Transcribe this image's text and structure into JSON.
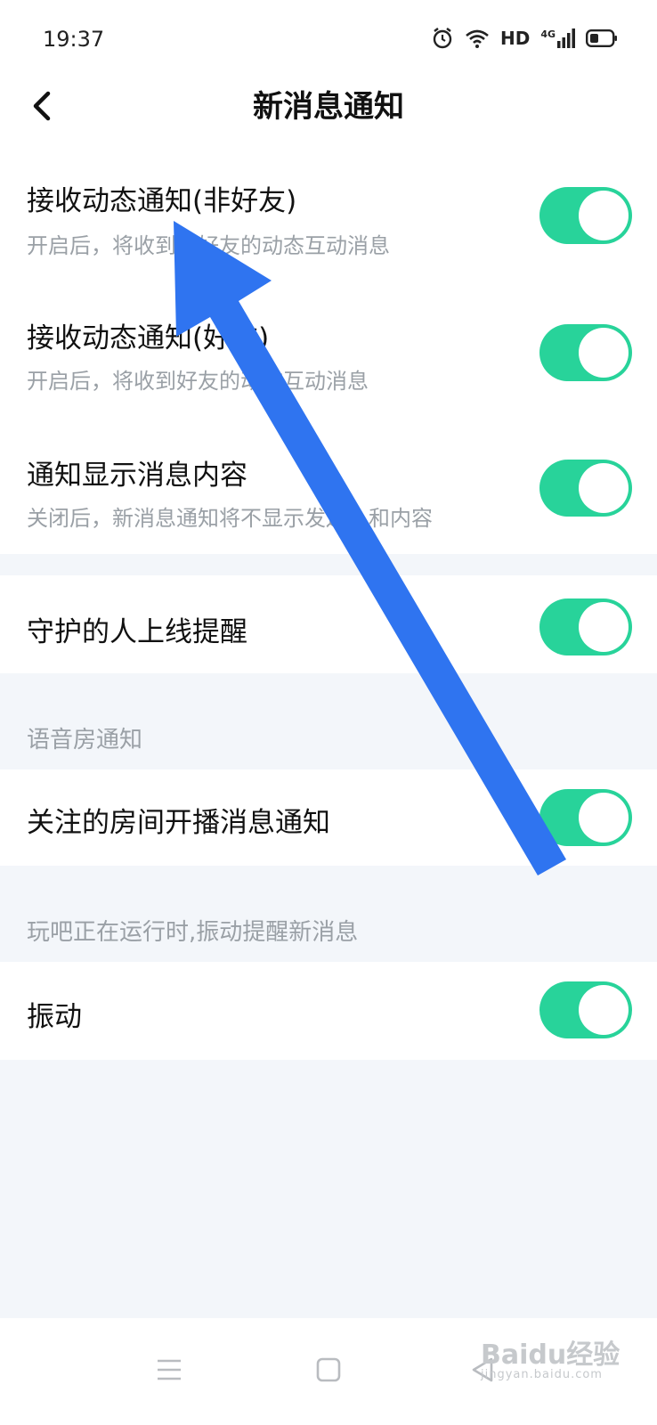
{
  "status": {
    "time": "19:37",
    "hd": "HD",
    "net": "4G"
  },
  "header": {
    "title": "新消息通知"
  },
  "settings": [
    {
      "title": "接收动态通知(非好友)",
      "subtitle": "开启后，将收到非好友的动态互动消息",
      "enabled": true
    },
    {
      "title": "接收动态通知(好友)",
      "subtitle": "开启后，将收到好友的动态互动消息",
      "enabled": true
    },
    {
      "title": "通知显示消息内容",
      "subtitle": "关闭后，新消息通知将不显示发送人和内容",
      "enabled": true
    },
    {
      "title": "守护的人上线提醒",
      "enabled": true
    }
  ],
  "voice_room": {
    "label": "语音房通知",
    "item": {
      "title": "关注的房间开播消息通知",
      "enabled": true
    }
  },
  "vibration": {
    "label": "玩吧正在运行时,振动提醒新消息",
    "item": {
      "title": "振动",
      "enabled": true
    }
  },
  "watermark": {
    "text": "Baidu经验",
    "sub": "jingyan.baidu.com"
  },
  "colors": {
    "toggle_on": "#28d39a",
    "annotation_arrow": "#2f74f0",
    "background": "#f3f6fa"
  },
  "icons": [
    "alarm-icon",
    "wifi-icon",
    "signal-icon",
    "battery-icon",
    "back-arrow-icon",
    "menu-icon",
    "home-square-icon",
    "back-triangle-icon"
  ]
}
